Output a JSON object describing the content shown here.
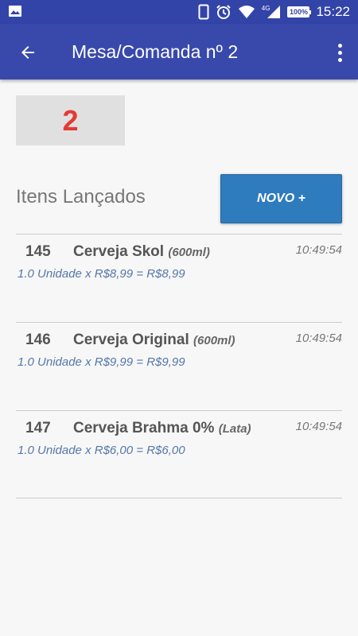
{
  "status_bar": {
    "time": "15:22",
    "network": "4G",
    "battery": "100%"
  },
  "app_bar": {
    "title": "Mesa/Comanda nº 2"
  },
  "table": {
    "number": "2"
  },
  "items_section": {
    "label": "Itens Lançados",
    "new_button": "NOVO +"
  },
  "items": [
    {
      "code": "145",
      "name": "Cerveja Skol",
      "size": "(600ml)",
      "time": "10:49:54",
      "detail": "1.0 Unidade x R$8,99 = R$8,99"
    },
    {
      "code": "146",
      "name": "Cerveja Original",
      "size": "(600ml)",
      "time": "10:49:54",
      "detail": "1.0 Unidade x R$9,99 = R$9,99"
    },
    {
      "code": "147",
      "name": "Cerveja Brahma 0%",
      "size": "(Lata)",
      "time": "10:49:54",
      "detail": "1.0 Unidade x R$6,00 = R$6,00"
    }
  ],
  "colors": {
    "app_bar": "#3949ab",
    "status_bar": "#3344a8",
    "table_number": "#e53935",
    "new_button": "#2e7bbd",
    "detail_text": "#5577aa"
  }
}
